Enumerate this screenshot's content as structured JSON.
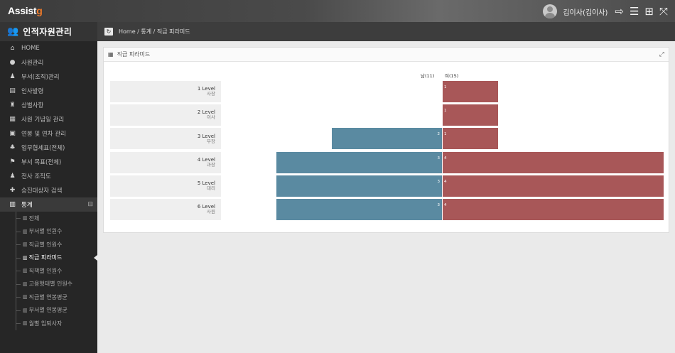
{
  "app": {
    "logo_main": "Assist",
    "logo_accent": "g"
  },
  "header": {
    "user": "김이사(김이사)",
    "icons": [
      "logout-icon",
      "menu-icon",
      "grid-icon",
      "fullscreen-icon"
    ]
  },
  "sidebar": {
    "title": "인적자원관리",
    "items": [
      {
        "label": "HOME",
        "icon": "home-icon"
      },
      {
        "label": "사원관리",
        "icon": "user-icon"
      },
      {
        "label": "부서(조직)관리",
        "icon": "group-icon"
      },
      {
        "label": "인사발령",
        "icon": "document-icon"
      },
      {
        "label": "상벌사항",
        "icon": "trophy-icon"
      },
      {
        "label": "사원 기념일 관리",
        "icon": "calendar-icon"
      },
      {
        "label": "연봉 및 연차 관리",
        "icon": "money-icon"
      },
      {
        "label": "업무협세표(전체)",
        "icon": "sitemap-icon"
      },
      {
        "label": "부서 목표(전체)",
        "icon": "flag-icon"
      },
      {
        "label": "전사 조직도",
        "icon": "org-icon"
      },
      {
        "label": "승진대상자 검색",
        "icon": "thumbs-up-icon"
      },
      {
        "label": "통계",
        "icon": "chart-icon",
        "toggle": "⊟"
      }
    ],
    "sub_items": [
      "전체",
      "부서별 인원수",
      "직급별 인원수",
      "직급 피라미드",
      "직책별 인원수",
      "고용형태별 인원수",
      "직급별 연봉평균",
      "부서별 연봉평균",
      "월별 입퇴사자"
    ],
    "current_sub": 3
  },
  "breadcrumb": {
    "text": "Home / 통계 / 직급 피라미드"
  },
  "panel": {
    "title": "직급 피라미드"
  },
  "chart_data": {
    "type": "bar",
    "legend": [
      "남(11)",
      "여(15)"
    ],
    "categories": [
      {
        "level": "1 Level",
        "rank": "사장"
      },
      {
        "level": "2 Level",
        "rank": "이사"
      },
      {
        "level": "3 Level",
        "rank": "부장"
      },
      {
        "level": "4 Level",
        "rank": "과장"
      },
      {
        "level": "5 Level",
        "rank": "대리"
      },
      {
        "level": "6 Level",
        "rank": "사원"
      }
    ],
    "series": [
      {
        "name": "남",
        "values": [
          0,
          0,
          2,
          3,
          3,
          3
        ],
        "color": "#5a8aa1"
      },
      {
        "name": "여",
        "values": [
          1,
          1,
          1,
          4,
          4,
          4
        ],
        "color": "#a85758"
      }
    ],
    "xlim": [
      -4,
      4
    ]
  }
}
